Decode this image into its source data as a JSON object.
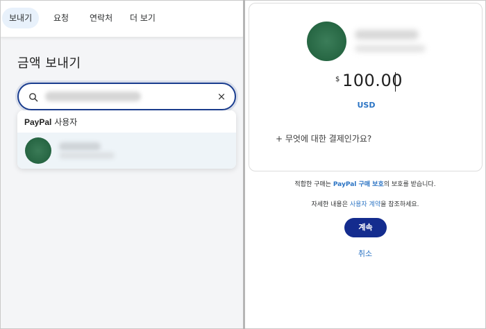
{
  "nav": {
    "tabs": [
      {
        "label": "보내기",
        "active": true
      },
      {
        "label": "요청",
        "active": false
      },
      {
        "label": "연락처",
        "active": false
      },
      {
        "label": "더 보기",
        "active": false
      }
    ]
  },
  "send_panel": {
    "title": "금액 보내기",
    "search_icon": "search-icon",
    "clear_icon": "close-icon",
    "clear_glyph": "×",
    "dropdown": {
      "brand": "PayPal",
      "header_suffix": " 사용자"
    }
  },
  "payment_card": {
    "currency_symbol": "$",
    "amount": "100.00",
    "currency_code": "USD",
    "add_note": "+ 무엇에 대한 결제인가요?"
  },
  "footer": {
    "protection_prefix": "적합한 구매는 ",
    "protection_link": "PayPal 구매 보호",
    "protection_suffix": "의 보호를 받습니다.",
    "agreement_prefix": "자세한 내용은 ",
    "agreement_link": "사용자 계약",
    "agreement_suffix": "을 참조하세요.",
    "continue_label": "계속",
    "cancel_label": "취소"
  },
  "colors": {
    "primary_button": "#142c8e",
    "link": "#2b74c4",
    "avatar": "#2a6b47",
    "search_border": "#1a3d8f"
  }
}
